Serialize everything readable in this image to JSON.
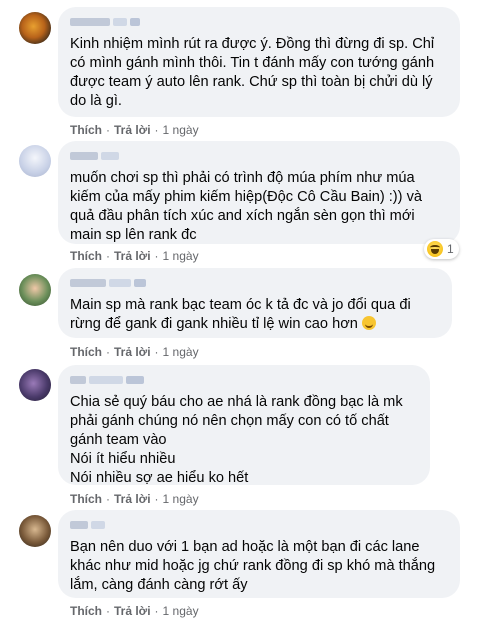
{
  "colors": {
    "bubble": "#f0f2f5",
    "meta": "#65676b",
    "text": "#050505"
  },
  "comments": [
    {
      "text": "Kinh nhiệm mình rút ra được ý. Đồng thì đừng đi sp. Chỉ có mình gánh mình thôi. Tin t đánh mấy con tướng gánh được team ý auto lên rank. Chứ sp thì toàn bị chửi dù lý do là gì.",
      "like": "Thích",
      "reply": "Trả lời",
      "time": "1 ngày"
    },
    {
      "text": "muốn chơi sp thì phải có trình độ múa phím như múa kiếm của mấy phim kiếm hiệp(Độc Cô Cầu Bain) :)) và quả đầu phân tích xúc and xích ngắn sèn gọn thì mới main sp lên rank đc",
      "like": "Thích",
      "reply": "Trả lời",
      "time": "1 ngày",
      "reaction": {
        "icon": "haha-reaction-icon",
        "count": "1"
      }
    },
    {
      "text": "Main sp mà rank bạc team óc k tả đc và jo đổi qua đi rừng để gank đi gank nhiều tỉ lệ win cao hơn",
      "emoji": "smiling-face-icon",
      "like": "Thích",
      "reply": "Trả lời",
      "time": "1 ngày"
    },
    {
      "text": "Chia sẻ quý báu cho ae nhá là rank đồng bạc là mk phải gánh chúng nó nên chọn mấy con có tố chất gánh team vào\nNói ít hiểu nhiều\nNói nhiều sợ ae hiểu ko hết",
      "like": "Thích",
      "reply": "Trả lời",
      "time": "1 ngày"
    },
    {
      "text": "Bạn nên duo với 1 bạn ad hoặc là một bạn đi các lane khác như mid hoặc jg chứ rank đồng đi sp khó mà thắng lắm, càng đánh càng rớt ấy",
      "like": "Thích",
      "reply": "Trả lời",
      "time": "1 ngày"
    }
  ]
}
